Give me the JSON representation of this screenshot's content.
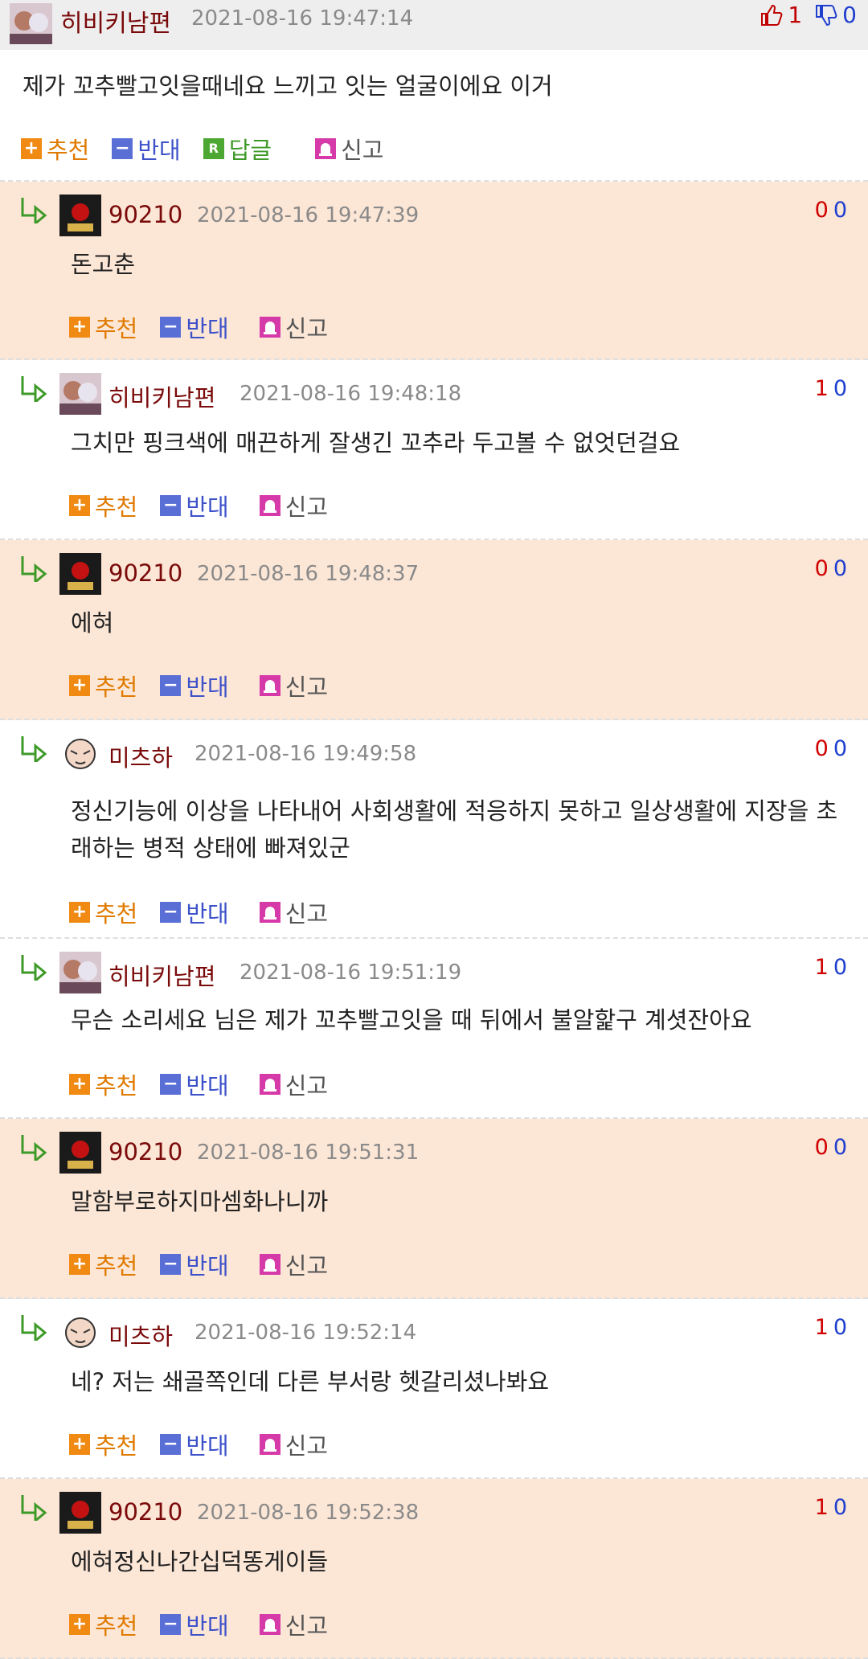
{
  "post": {
    "nick": "히비키남편",
    "date": "2021-08-16 19:47:14",
    "up": "1",
    "down": "0",
    "text": "제가 꼬추빨고잇을때네요 느끼고 잇는 얼굴이에요 이거"
  },
  "labels": {
    "recommend": "추천",
    "oppose": "반대",
    "reply": "답글",
    "report": "신고"
  },
  "replies": [
    {
      "nick": "90210",
      "date": "2021-08-16 19:47:39",
      "up": "0",
      "down": "0",
      "text": "돈고춘"
    },
    {
      "nick": "히비키남편",
      "date": "2021-08-16 19:48:18",
      "up": "1",
      "down": "0",
      "text": "그치만 핑크색에 매끈하게 잘생긴 꼬추라 두고볼 수 없엇던걸요"
    },
    {
      "nick": "90210",
      "date": "2021-08-16 19:48:37",
      "up": "0",
      "down": "0",
      "text": "에혀"
    },
    {
      "nick": "미츠하",
      "date": "2021-08-16 19:49:58",
      "up": "0",
      "down": "0",
      "text": "정신기능에 이상을 나타내어 사회생활에 적응하지 못하고 일상생활에 지장을 초래하는 병적 상태에 빠져있군"
    },
    {
      "nick": "히비키남편",
      "date": "2021-08-16 19:51:19",
      "up": "1",
      "down": "0",
      "text": "무슨 소리세요 님은 제가 꼬추빨고잇을 때 뒤에서 불알핥구 계셧잔아요"
    },
    {
      "nick": "90210",
      "date": "2021-08-16 19:51:31",
      "up": "0",
      "down": "0",
      "text": "말함부로하지마셈화나니까"
    },
    {
      "nick": "미츠하",
      "date": "2021-08-16 19:52:14",
      "up": "1",
      "down": "0",
      "text": "네? 저는 쇄골쪽인데 다른 부서랑 헷갈리셨나봐요"
    },
    {
      "nick": "90210",
      "date": "2021-08-16 19:52:38",
      "up": "1",
      "down": "0",
      "text": "에혀정신나간십덕똥게이들"
    }
  ]
}
